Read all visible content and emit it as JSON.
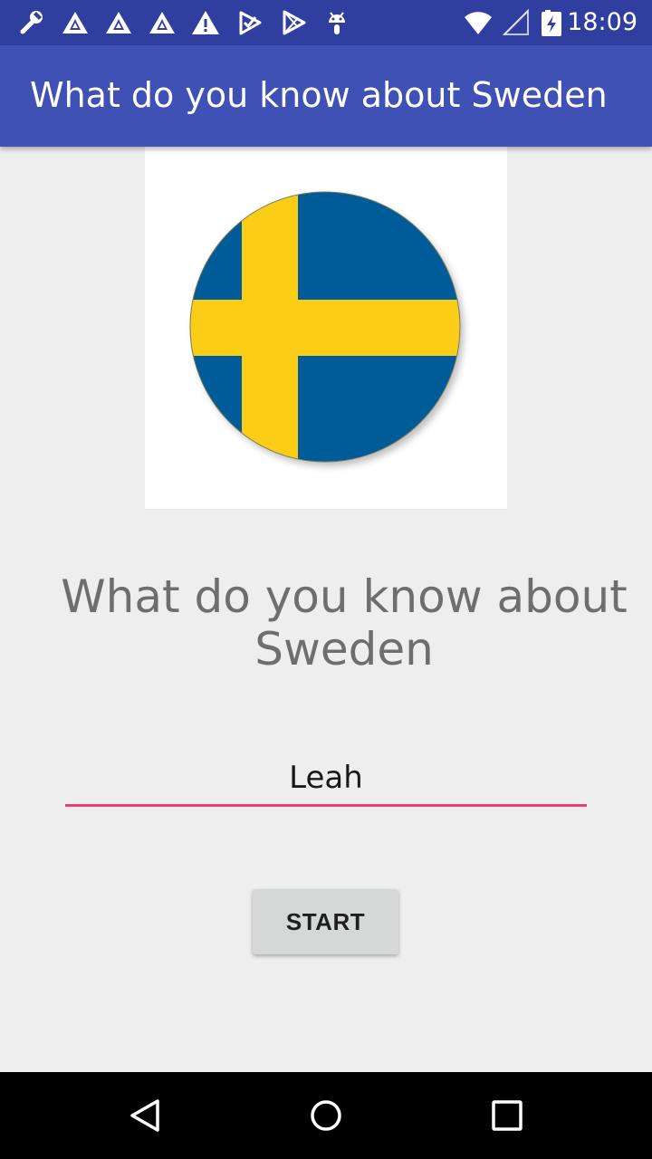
{
  "status_bar": {
    "time": "18:09",
    "icons": [
      "wrench-icon",
      "notification-icon",
      "notification-icon",
      "notification-icon",
      "warning-icon",
      "notification-icon",
      "play-store-icon",
      "android-icon",
      "wifi-icon",
      "signal-icon",
      "battery-charging-icon"
    ]
  },
  "app_bar": {
    "title": "What do you know about Sweden"
  },
  "main": {
    "flag_image": "sweden-flag",
    "headline": "What do you know about Sweden",
    "name_input_value": "Leah",
    "start_label": "START"
  },
  "colors": {
    "primary": "#3f51b5",
    "primary_dark": "#303f9f",
    "accent": "#ec407a",
    "flag_blue": "#005b99",
    "flag_yellow": "#fecc00"
  },
  "nav_bar": {
    "icons": [
      "back-icon",
      "home-icon",
      "recents-icon"
    ]
  }
}
